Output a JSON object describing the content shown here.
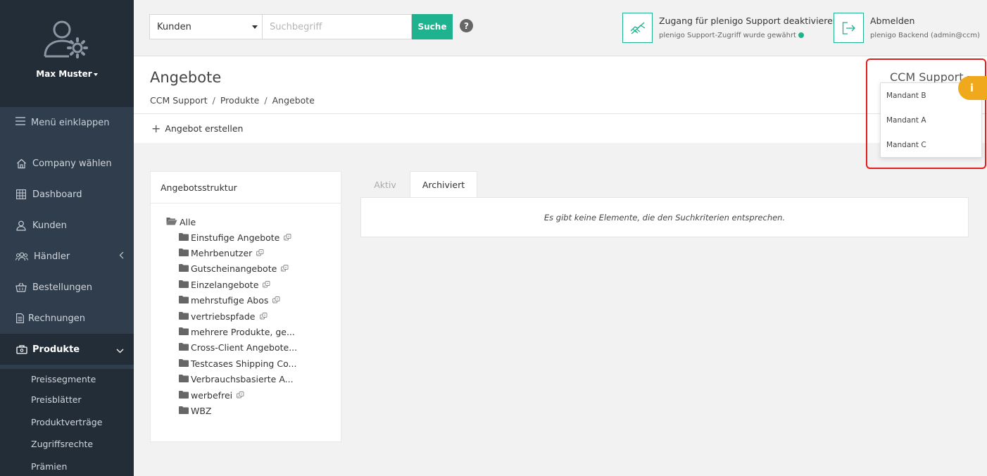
{
  "sidebar": {
    "user_name": "Max Muster",
    "collapse_label": "Menü einklappen",
    "items": [
      {
        "label": "Company wählen",
        "icon": "home-icon"
      },
      {
        "label": "Dashboard",
        "icon": "grid-icon"
      },
      {
        "label": "Kunden",
        "icon": "user-icon"
      },
      {
        "label": "Händler",
        "icon": "users-icon"
      },
      {
        "label": "Bestellungen",
        "icon": "basket-icon"
      },
      {
        "label": "Rechnungen",
        "icon": "document-icon"
      },
      {
        "label": "Produkte",
        "icon": "products-icon"
      }
    ],
    "sub_items": [
      "Preissegmente",
      "Preisblätter",
      "Produktverträge",
      "Zugriffsrechte",
      "Prämien"
    ]
  },
  "topbar": {
    "search_category": "Kunden",
    "search_placeholder": "Suchbegriff",
    "search_button": "Suche",
    "help": "?",
    "support_title": "Zugang für plenigo Support deaktivieren",
    "support_sub": "plenigo Support-Zugriff wurde gewährt",
    "logout_title": "Abmelden",
    "logout_sub": "plenigo Backend (admin@ccm)"
  },
  "page": {
    "title": "Angebote",
    "breadcrumb": [
      "CCM Support",
      "Produkte",
      "Angebote"
    ],
    "create_action": "Angebot erstellen"
  },
  "tenant": {
    "current": "CCM Support",
    "options": [
      "Mandant B",
      "Mandant A",
      "Mandant C"
    ],
    "info_badge": "i"
  },
  "tree": {
    "header": "Angebotsstruktur",
    "root": "Alle",
    "nodes": [
      {
        "label": "Einstufige Angebote",
        "dice": true
      },
      {
        "label": "Mehrbenutzer",
        "dice": true
      },
      {
        "label": "Gutscheinangebote",
        "dice": true
      },
      {
        "label": "Einzelangebote",
        "dice": true
      },
      {
        "label": "mehrstufige Abos",
        "dice": true
      },
      {
        "label": "vertriebspfade",
        "dice": true
      },
      {
        "label": "mehrere Produkte, ge...",
        "dice": false
      },
      {
        "label": "Cross-Client Angebote...",
        "dice": false
      },
      {
        "label": "Testcases Shipping Co...",
        "dice": false
      },
      {
        "label": "Verbrauchsbasierte A...",
        "dice": false
      },
      {
        "label": "werbefrei",
        "dice": true
      },
      {
        "label": "WBZ",
        "dice": false
      }
    ]
  },
  "tabs": {
    "items": [
      "Aktiv",
      "Archiviert"
    ],
    "active": "Archiviert",
    "empty_message": "Es gibt keine Elemente, die den Suchkriterien entsprechen."
  },
  "colors": {
    "accent": "#1fb28f",
    "sidebar": "#2f3d4c",
    "sidebar_dark": "#222d38",
    "info": "#f0a81c",
    "highlight": "#e31d1d"
  }
}
